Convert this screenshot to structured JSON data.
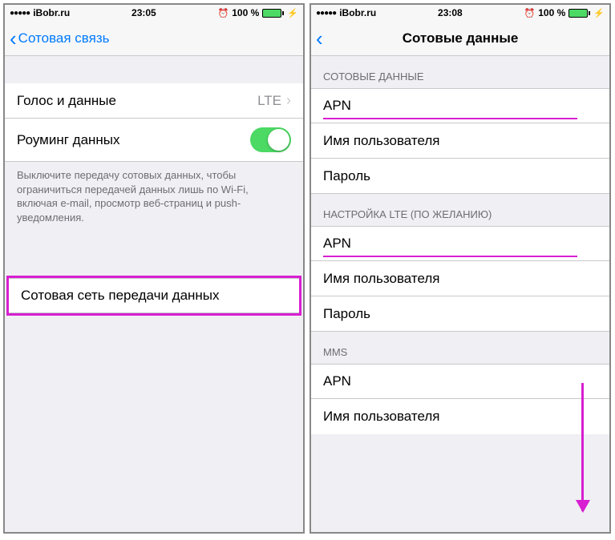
{
  "left": {
    "status": {
      "carrier": "iBobr.ru",
      "time": "23:05",
      "alarm": "⏰",
      "battery_pct": "100 %"
    },
    "nav": {
      "back_label": "Сотовая связь"
    },
    "cells": {
      "voice_data_label": "Голос и данные",
      "voice_data_value": "LTE",
      "roaming_label": "Роуминг данных"
    },
    "footer": "Выключите передачу сотовых данных, чтобы ограничиться передачей данных лишь по Wi-Fi, включая e-mail, просмотр веб-страниц и push-уведомления.",
    "network_cell": "Сотовая сеть передачи данных"
  },
  "right": {
    "status": {
      "carrier": "iBobr.ru",
      "time": "23:08",
      "alarm": "⏰",
      "battery_pct": "100 %"
    },
    "nav": {
      "title": "Сотовые данные"
    },
    "sections": {
      "s1_header": "СОТОВЫЕ ДАННЫЕ",
      "s1_apn": "APN",
      "s1_user": "Имя пользователя",
      "s1_pass": "Пароль",
      "s2_header": "НАСТРОЙКА LTE (ПО ЖЕЛАНИЮ)",
      "s2_apn": "APN",
      "s2_user": "Имя пользователя",
      "s2_pass": "Пароль",
      "s3_header": "MMS",
      "s3_apn": "APN",
      "s3_user": "Имя пользователя"
    }
  }
}
